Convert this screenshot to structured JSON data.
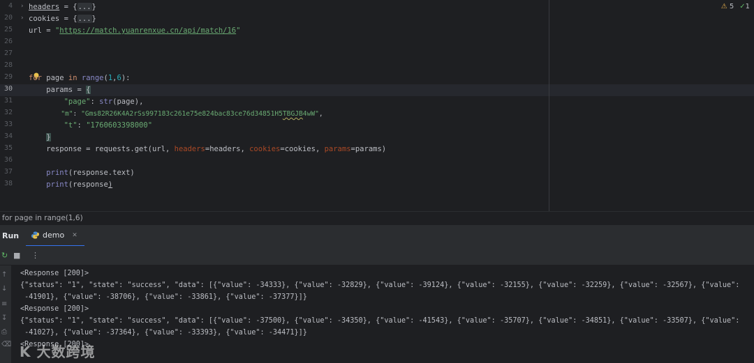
{
  "editor": {
    "line_numbers": [
      "4",
      "20",
      "25",
      "26",
      "27",
      "28",
      "29",
      "30",
      "31",
      "32",
      "33",
      "34",
      "35",
      "36",
      "37",
      "38"
    ],
    "lines": {
      "l4": {
        "a": "headers",
        "b": " = {",
        "c": "...",
        "d": "}"
      },
      "l20": {
        "a": "cookies = {",
        "c": "...",
        "d": "}"
      },
      "l25": {
        "a": "url = ",
        "q1": "\"",
        "url": "https://match.yuanrenxue.cn/api/match/16",
        "q2": "\""
      },
      "l29": {
        "kw1": "for",
        "a": " page ",
        "kw2": "in",
        "b": " ",
        "fn": "range",
        "c": "(",
        "n1": "1",
        "d": ",",
        "n2": "6",
        "e": "):"
      },
      "l30": {
        "a": "    params = ",
        "brace": "{"
      },
      "l31": {
        "indent": "        ",
        "key": "\"page\"",
        "a": ": ",
        "bi": "str",
        "b": "(page),"
      },
      "l32": {
        "indent": "        ",
        "key": "\"m\"",
        "a": ": ",
        "v1": "\"Gms82R26K4A2rSs997183c261e75e824bac83ce76d34851H5",
        "v2": "TBGJB",
        "v3": "4wW\"",
        "b": ","
      },
      "l33": {
        "indent": "        ",
        "key": "\"t\"",
        "a": ": ",
        "v": "\"1760603398000\""
      },
      "l34": {
        "indent": "    ",
        "brace": "}"
      },
      "l35": {
        "a": "    response = requests.get(url, ",
        "p1": "headers",
        "b": "=headers, ",
        "p2": "cookies",
        "c": "=cookies, ",
        "p3": "params",
        "d": "=params)"
      },
      "l37": {
        "a": "    ",
        "bi": "print",
        "b": "(response.text)"
      },
      "l38": {
        "a": "    ",
        "bi": "print",
        "b": "(response",
        "c": ")"
      }
    },
    "inspection": {
      "warnings": "5",
      "checks": "1"
    }
  },
  "breadcrumb": "for page in range(1,6)",
  "run": {
    "title": "Run",
    "tab_label": "demo"
  },
  "console": {
    "lines": [
      "<Response [200]>",
      "{\"status\": \"1\", \"state\": \"success\", \"data\": [{\"value\": -34333}, {\"value\": -32829}, {\"value\": -39124}, {\"value\": -32155}, {\"value\": -32259}, {\"value\": -32567}, {\"value\":",
      " -41901}, {\"value\": -38706}, {\"value\": -33861}, {\"value\": -37377}]}",
      "<Response [200]>",
      "{\"status\": \"1\", \"state\": \"success\", \"data\": [{\"value\": -37500}, {\"value\": -34350}, {\"value\": -41543}, {\"value\": -35707}, {\"value\": -34851}, {\"value\": -33507}, {\"value\":",
      " -41027}, {\"value\": -37364}, {\"value\": -33393}, {\"value\": -34471}]}",
      "<Response [200]>"
    ]
  },
  "watermark": "大数跨境",
  "colors": {
    "background": "#1e1f22",
    "panel": "#2b2d30",
    "keyword": "#cf8e6d",
    "string": "#6aab73",
    "number": "#2aacb8",
    "accent": "#3574f0"
  }
}
